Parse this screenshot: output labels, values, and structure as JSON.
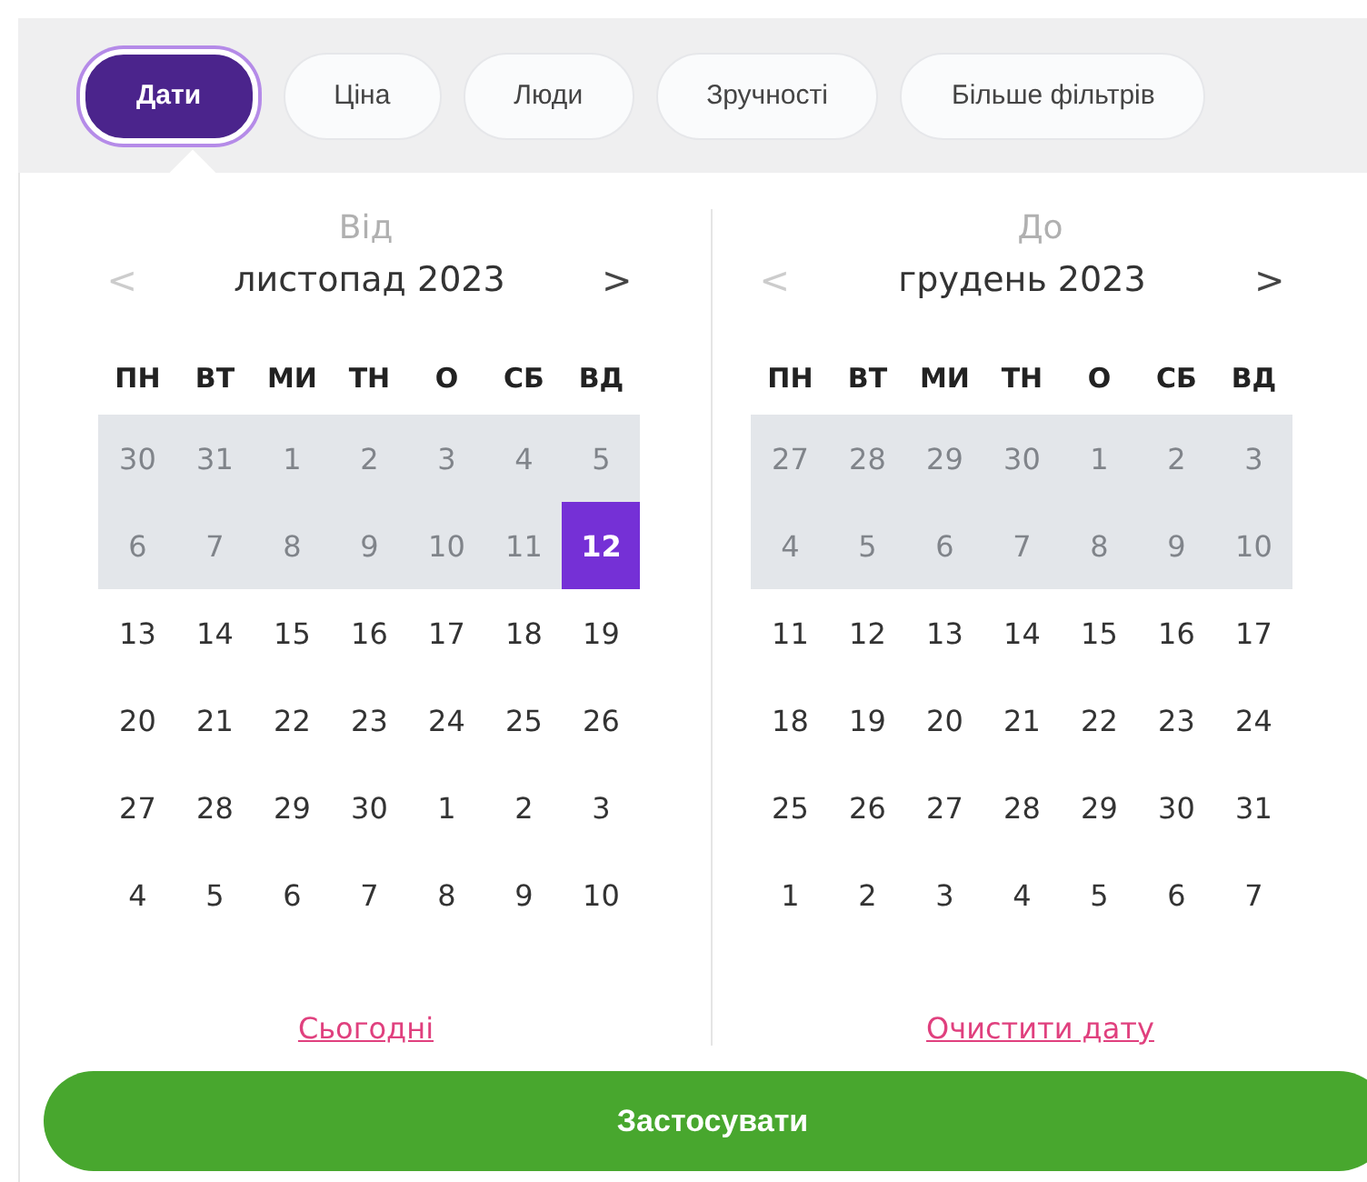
{
  "filters": [
    {
      "label": "Дати",
      "selected": true
    },
    {
      "label": "Ціна",
      "selected": false
    },
    {
      "label": "Люди",
      "selected": false
    },
    {
      "label": "Зручності",
      "selected": false
    },
    {
      "label": "Більше фільтрів",
      "selected": false
    }
  ],
  "calendars": [
    {
      "caption": "Від",
      "month": "листопад 2023",
      "prev": {
        "symbol": "<",
        "disabled": true
      },
      "next": {
        "symbol": ">",
        "disabled": false
      },
      "weekdays": [
        "ПН",
        "ВТ",
        "МИ",
        "ТН",
        "О",
        "СБ",
        "ВД"
      ],
      "weeks": [
        [
          {
            "d": "30",
            "disabled": true,
            "selected": false
          },
          {
            "d": "31",
            "disabled": true,
            "selected": false
          },
          {
            "d": "1",
            "disabled": true,
            "selected": false
          },
          {
            "d": "2",
            "disabled": true,
            "selected": false
          },
          {
            "d": "3",
            "disabled": true,
            "selected": false
          },
          {
            "d": "4",
            "disabled": true,
            "selected": false
          },
          {
            "d": "5",
            "disabled": true,
            "selected": false
          }
        ],
        [
          {
            "d": "6",
            "disabled": true,
            "selected": false
          },
          {
            "d": "7",
            "disabled": true,
            "selected": false
          },
          {
            "d": "8",
            "disabled": true,
            "selected": false
          },
          {
            "d": "9",
            "disabled": true,
            "selected": false
          },
          {
            "d": "10",
            "disabled": true,
            "selected": false
          },
          {
            "d": "11",
            "disabled": true,
            "selected": false
          },
          {
            "d": "12",
            "disabled": false,
            "selected": true
          }
        ],
        [
          {
            "d": "13",
            "disabled": false,
            "selected": false
          },
          {
            "d": "14",
            "disabled": false,
            "selected": false
          },
          {
            "d": "15",
            "disabled": false,
            "selected": false
          },
          {
            "d": "16",
            "disabled": false,
            "selected": false
          },
          {
            "d": "17",
            "disabled": false,
            "selected": false
          },
          {
            "d": "18",
            "disabled": false,
            "selected": false
          },
          {
            "d": "19",
            "disabled": false,
            "selected": false
          }
        ],
        [
          {
            "d": "20",
            "disabled": false,
            "selected": false
          },
          {
            "d": "21",
            "disabled": false,
            "selected": false
          },
          {
            "d": "22",
            "disabled": false,
            "selected": false
          },
          {
            "d": "23",
            "disabled": false,
            "selected": false
          },
          {
            "d": "24",
            "disabled": false,
            "selected": false
          },
          {
            "d": "25",
            "disabled": false,
            "selected": false
          },
          {
            "d": "26",
            "disabled": false,
            "selected": false
          }
        ],
        [
          {
            "d": "27",
            "disabled": false,
            "selected": false
          },
          {
            "d": "28",
            "disabled": false,
            "selected": false
          },
          {
            "d": "29",
            "disabled": false,
            "selected": false
          },
          {
            "d": "30",
            "disabled": false,
            "selected": false
          },
          {
            "d": "1",
            "disabled": false,
            "selected": false
          },
          {
            "d": "2",
            "disabled": false,
            "selected": false
          },
          {
            "d": "3",
            "disabled": false,
            "selected": false
          }
        ],
        [
          {
            "d": "4",
            "disabled": false,
            "selected": false
          },
          {
            "d": "5",
            "disabled": false,
            "selected": false
          },
          {
            "d": "6",
            "disabled": false,
            "selected": false
          },
          {
            "d": "7",
            "disabled": false,
            "selected": false
          },
          {
            "d": "8",
            "disabled": false,
            "selected": false
          },
          {
            "d": "9",
            "disabled": false,
            "selected": false
          },
          {
            "d": "10",
            "disabled": false,
            "selected": false
          }
        ]
      ],
      "link": "Сьогодні"
    },
    {
      "caption": "До",
      "month": "грудень 2023",
      "prev": {
        "symbol": "<",
        "disabled": true
      },
      "next": {
        "symbol": ">",
        "disabled": false
      },
      "weekdays": [
        "ПН",
        "ВТ",
        "МИ",
        "ТН",
        "О",
        "СБ",
        "ВД"
      ],
      "weeks": [
        [
          {
            "d": "27",
            "disabled": true,
            "selected": false
          },
          {
            "d": "28",
            "disabled": true,
            "selected": false
          },
          {
            "d": "29",
            "disabled": true,
            "selected": false
          },
          {
            "d": "30",
            "disabled": true,
            "selected": false
          },
          {
            "d": "1",
            "disabled": true,
            "selected": false
          },
          {
            "d": "2",
            "disabled": true,
            "selected": false
          },
          {
            "d": "3",
            "disabled": true,
            "selected": false
          }
        ],
        [
          {
            "d": "4",
            "disabled": true,
            "selected": false
          },
          {
            "d": "5",
            "disabled": true,
            "selected": false
          },
          {
            "d": "6",
            "disabled": true,
            "selected": false
          },
          {
            "d": "7",
            "disabled": true,
            "selected": false
          },
          {
            "d": "8",
            "disabled": true,
            "selected": false
          },
          {
            "d": "9",
            "disabled": true,
            "selected": false
          },
          {
            "d": "10",
            "disabled": true,
            "selected": false
          }
        ],
        [
          {
            "d": "11",
            "disabled": false,
            "selected": false
          },
          {
            "d": "12",
            "disabled": false,
            "selected": false
          },
          {
            "d": "13",
            "disabled": false,
            "selected": false
          },
          {
            "d": "14",
            "disabled": false,
            "selected": false
          },
          {
            "d": "15",
            "disabled": false,
            "selected": false
          },
          {
            "d": "16",
            "disabled": false,
            "selected": false
          },
          {
            "d": "17",
            "disabled": false,
            "selected": false
          }
        ],
        [
          {
            "d": "18",
            "disabled": false,
            "selected": false
          },
          {
            "d": "19",
            "disabled": false,
            "selected": false
          },
          {
            "d": "20",
            "disabled": false,
            "selected": false
          },
          {
            "d": "21",
            "disabled": false,
            "selected": false
          },
          {
            "d": "22",
            "disabled": false,
            "selected": false
          },
          {
            "d": "23",
            "disabled": false,
            "selected": false
          },
          {
            "d": "24",
            "disabled": false,
            "selected": false
          }
        ],
        [
          {
            "d": "25",
            "disabled": false,
            "selected": false
          },
          {
            "d": "26",
            "disabled": false,
            "selected": false
          },
          {
            "d": "27",
            "disabled": false,
            "selected": false
          },
          {
            "d": "28",
            "disabled": false,
            "selected": false
          },
          {
            "d": "29",
            "disabled": false,
            "selected": false
          },
          {
            "d": "30",
            "disabled": false,
            "selected": false
          },
          {
            "d": "31",
            "disabled": false,
            "selected": false
          }
        ],
        [
          {
            "d": "1",
            "disabled": false,
            "selected": false
          },
          {
            "d": "2",
            "disabled": false,
            "selected": false
          },
          {
            "d": "3",
            "disabled": false,
            "selected": false
          },
          {
            "d": "4",
            "disabled": false,
            "selected": false
          },
          {
            "d": "5",
            "disabled": false,
            "selected": false
          },
          {
            "d": "6",
            "disabled": false,
            "selected": false
          },
          {
            "d": "7",
            "disabled": false,
            "selected": false
          }
        ]
      ],
      "link": "Очистити дату"
    }
  ],
  "apply_button": "Застосувати"
}
